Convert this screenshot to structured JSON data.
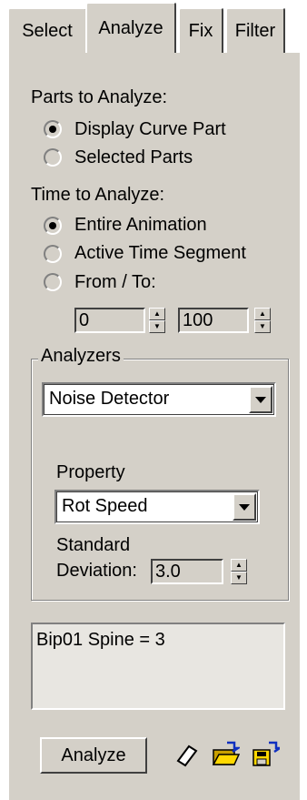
{
  "tabs": [
    "Select",
    "Analyze",
    "Fix",
    "Filter"
  ],
  "parts": {
    "heading": "Parts to Analyze:",
    "options": [
      "Display Curve Part",
      "Selected Parts"
    ],
    "selected_index": 0
  },
  "time": {
    "heading": "Time to Analyze:",
    "options": [
      "Entire Animation",
      "Active Time Segment",
      "From / To:"
    ],
    "selected_index": 0,
    "from_value": "0",
    "to_value": "100"
  },
  "analyzers": {
    "title": "Analyzers",
    "detector_value": "Noise Detector",
    "property_label": "Property",
    "property_value": "Rot Speed",
    "std_label_1": "Standard",
    "std_label_2": "Deviation:",
    "std_value": "3.0"
  },
  "results": {
    "line": "Bip01 Spine = 3"
  },
  "footer": {
    "analyze_label": "Analyze",
    "icons": [
      "eraser-icon",
      "open-folder-icon",
      "save-icon"
    ]
  }
}
